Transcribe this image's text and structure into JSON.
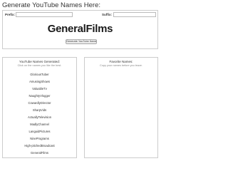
{
  "page": {
    "heading": "Generate YouTube Names Here:"
  },
  "form": {
    "prefix_label": "Prefix:",
    "prefix_value": "",
    "suffix_label": "Suffix:",
    "suffix_value": ""
  },
  "brand": {
    "name": "GeneralFilms"
  },
  "generate_button": {
    "label": "Generate YouTube Names"
  },
  "generated": {
    "title": "YouTube Names Generated:",
    "subtitle": "Click on the names you like the best.",
    "names": [
      "GloriousTuber",
      "AmusingShows",
      "ValuableTv",
      "NaughtyVlogger",
      "CowardlyDirector",
      "SharpVids",
      "ActuallyTelevision",
      "MadlyChannel",
      "LanguidPictures",
      "NinePrograms",
      "High-pitchedBroadcast",
      "GeneralFilms"
    ]
  },
  "favorites": {
    "title": "Favorite Names:",
    "subtitle": "Copy your names before you leave."
  }
}
